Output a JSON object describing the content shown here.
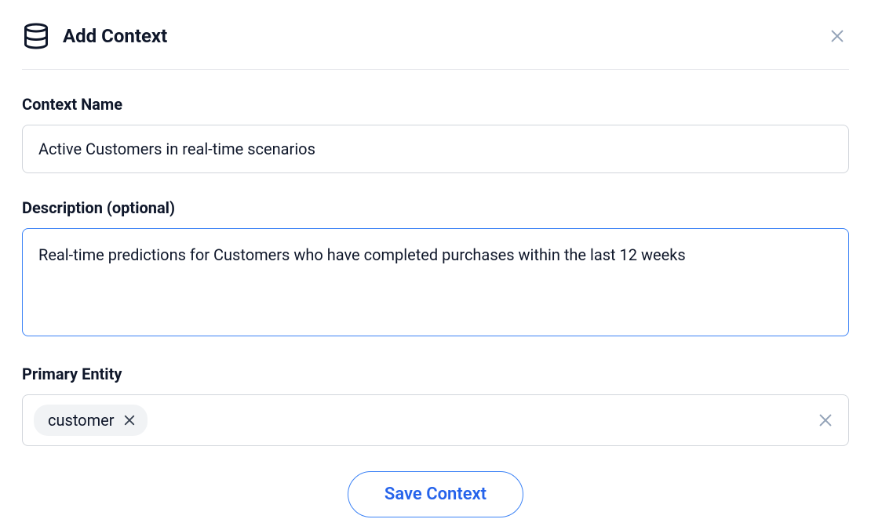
{
  "modal": {
    "title": "Add Context"
  },
  "fields": {
    "contextName": {
      "label": "Context Name",
      "value": "Active Customers in real-time scenarios"
    },
    "description": {
      "label": "Description (optional)",
      "value": "Real-time predictions for Customers who have completed purchases within the last 12 weeks"
    },
    "primaryEntity": {
      "label": "Primary Entity",
      "chips": [
        "customer"
      ]
    }
  },
  "actions": {
    "save": "Save Context"
  }
}
